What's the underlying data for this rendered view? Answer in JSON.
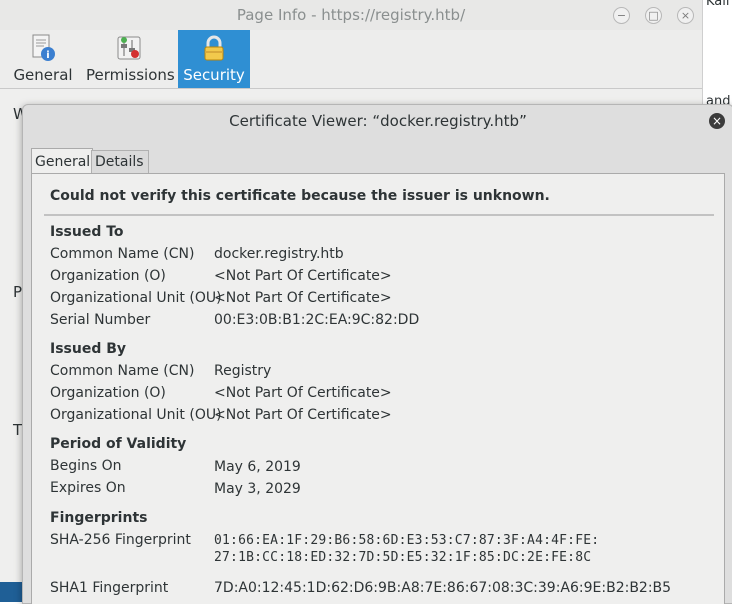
{
  "background_window": {
    "fragment_top": "Kali L",
    "fragment_mid": "and"
  },
  "page_info": {
    "title": "Page Info - https://registry.htb/",
    "controls": {
      "minimize": "−",
      "maximize": "□",
      "close": "×"
    },
    "tabs": [
      {
        "label": "General",
        "icon": "page-info-icon"
      },
      {
        "label": "Permissions",
        "icon": "permissions-icon"
      },
      {
        "label": "Security",
        "icon": "padlock-icon",
        "active": true
      }
    ],
    "background_letters": [
      "W",
      "P",
      "T"
    ]
  },
  "cert_viewer": {
    "title": "Certificate Viewer: “docker.registry.htb”",
    "close": "×",
    "tabs": [
      "General",
      "Details"
    ],
    "warning": "Could not verify this certificate because the issuer is unknown.",
    "issued_to": {
      "heading": "Issued To",
      "rows": [
        {
          "label": "Common Name (CN)",
          "value": "docker.registry.htb"
        },
        {
          "label": "Organization (O)",
          "value": "<Not Part Of Certificate>"
        },
        {
          "label": "Organizational Unit (OU)",
          "value": "<Not Part Of Certificate>"
        },
        {
          "label": "Serial Number",
          "value": "00:E3:0B:B1:2C:EA:9C:82:DD"
        }
      ]
    },
    "issued_by": {
      "heading": "Issued By",
      "rows": [
        {
          "label": "Common Name (CN)",
          "value": "Registry"
        },
        {
          "label": "Organization (O)",
          "value": "<Not Part Of Certificate>"
        },
        {
          "label": "Organizational Unit (OU)",
          "value": "<Not Part Of Certificate>"
        }
      ]
    },
    "validity": {
      "heading": "Period of Validity",
      "rows": [
        {
          "label": "Begins On",
          "value": "May 6, 2019"
        },
        {
          "label": "Expires On",
          "value": "May 3, 2029"
        }
      ]
    },
    "fingerprints": {
      "heading": "Fingerprints",
      "sha256_label": "SHA-256 Fingerprint",
      "sha256_value": "01:66:EA:1F:29:B6:58:6D:E3:53:C7:87:3F:A4:4F:FE:\n27:1B:CC:18:ED:32:7D:5D:E5:32:1F:85:DC:2E:FE:8C",
      "sha1_label": "SHA1 Fingerprint",
      "sha1_value": "7D:A0:12:45:1D:62:D6:9B:A8:7E:86:67:08:3C:39:A6:9E:B2:B2:B5"
    }
  },
  "colors": {
    "active_tab": "#2f8fd3",
    "dialog_bg": "#dedede",
    "panel_bg": "#efefee"
  }
}
